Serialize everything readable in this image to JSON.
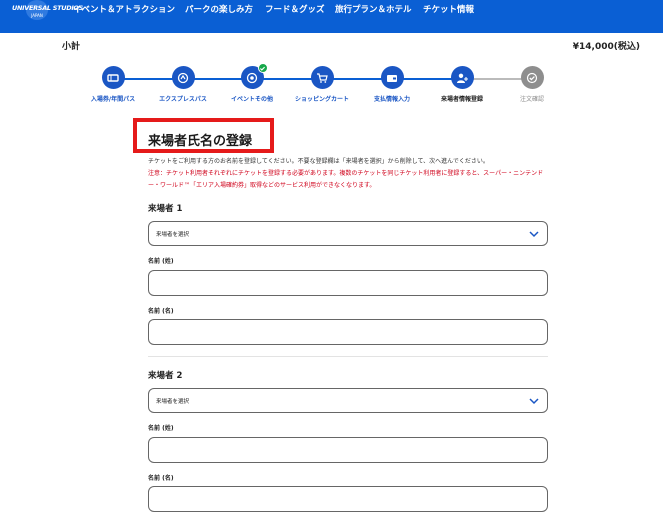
{
  "header": {
    "logo_text": "UNIVERSAL STUDIOS",
    "logo_sub": "JAPAN",
    "nav": [
      "イベント＆アトラクション",
      "パークの楽しみ方",
      "フード＆グッズ",
      "旅行プラン＆ホテル",
      "チケット情報"
    ]
  },
  "cart": {
    "subtotal_label": "小計",
    "subtotal_value": "¥14,000(税込)"
  },
  "steps": [
    {
      "label": "入場券/年間パス",
      "icon": "ticket-icon",
      "state": "done"
    },
    {
      "label": "エクスプレスパス",
      "icon": "express-icon",
      "state": "done"
    },
    {
      "label": "イベントその他",
      "icon": "event-icon",
      "state": "done"
    },
    {
      "label": "ショッピングカート",
      "icon": "cart-icon",
      "state": "done"
    },
    {
      "label": "支払情報入力",
      "icon": "wallet-icon",
      "state": "done"
    },
    {
      "label": "来場者情報登録",
      "icon": "user-add-icon",
      "state": "current"
    },
    {
      "label": "注文確認",
      "icon": "check-icon",
      "state": "pending"
    }
  ],
  "form": {
    "title": "来場者氏名の登録",
    "description": "チケットをご利用する方のお名前を登録してください。不要な登録欄は「来場者を選択」から削除して、次へ進んでください。",
    "notice": "注意：チケット利用者それぞれにチケットを登録する必要があります。複数のチケットを同じチケット利用者に登録すると、スーパー・ニンテンドー・ワールド™「エリア入場確約券」取得などのサービス利用ができなくなります。",
    "visitors": [
      {
        "heading": "来場者 1",
        "select_value": "来場者を選択",
        "last_name_label": "名前 (姓)",
        "first_name_label": "名前 (名)"
      },
      {
        "heading": "来場者 2",
        "select_value": "来場者を選択",
        "last_name_label": "名前 (姓)",
        "first_name_label": "名前 (名)"
      }
    ]
  },
  "colors": {
    "header_bg": "#0a5fd4",
    "step_active": "#1a56c4",
    "step_pending": "#8e8e8e",
    "highlight_box": "#e51a1a",
    "notice_text": "#d0021b",
    "done_badge": "#17a84a"
  }
}
